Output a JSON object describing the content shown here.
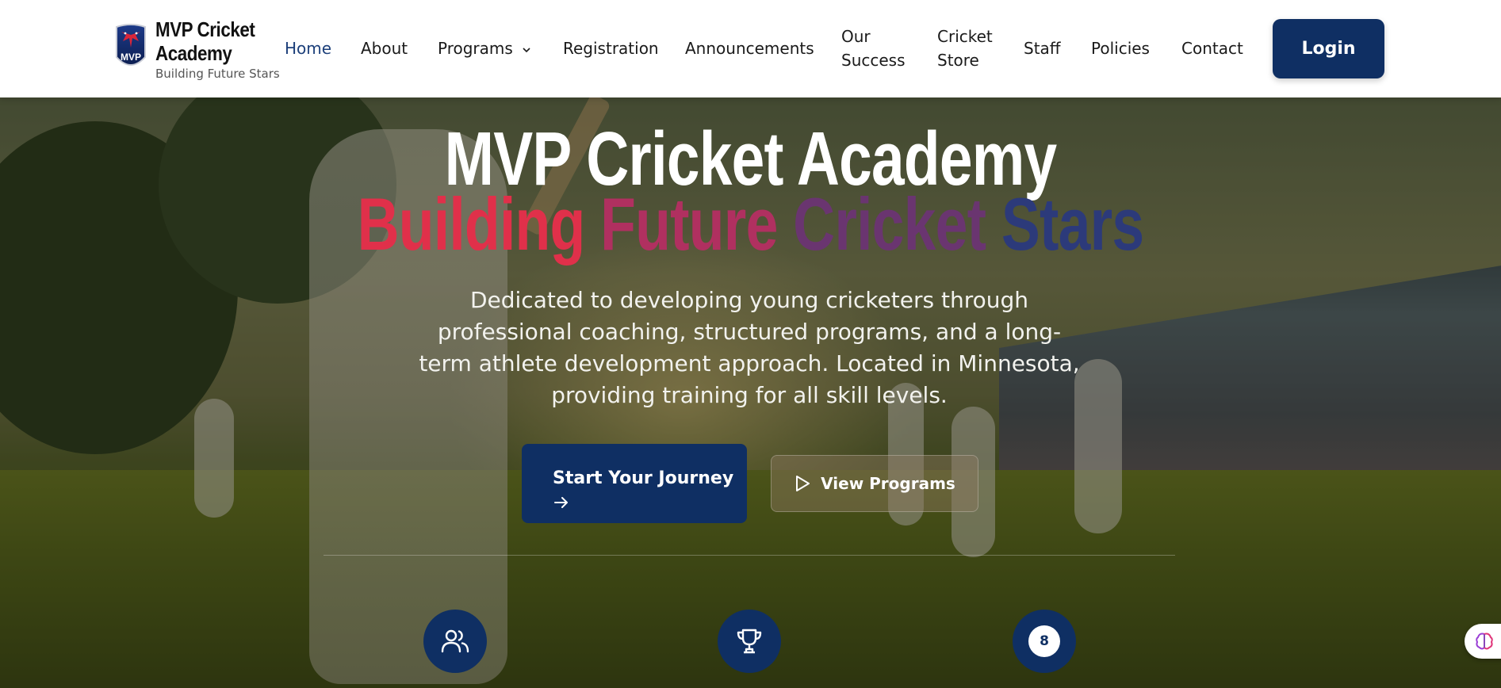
{
  "brand": {
    "name": "MVP Cricket Academy",
    "tagline": "Building Future Stars",
    "logo_text": "MVP"
  },
  "nav": {
    "items": [
      {
        "label": "Home",
        "active": true
      },
      {
        "label": "About"
      },
      {
        "label": "Programs",
        "has_dropdown": true
      },
      {
        "label": "Registration"
      },
      {
        "label": "Announcements"
      },
      {
        "label": "Our Success"
      },
      {
        "label": "Cricket Store"
      },
      {
        "label": "Staff"
      },
      {
        "label": "Policies"
      },
      {
        "label": "Contact"
      }
    ],
    "login_label": "Login"
  },
  "hero": {
    "title": "MVP Cricket Academy",
    "subtitle_words": [
      "Building",
      "Future",
      "Cricket",
      "Stars"
    ],
    "subtitle_colors": [
      "#e0304a",
      "#b03060",
      "#6a3570",
      "#2c3a7a"
    ],
    "description": "Dedicated to developing young cricketers through professional coaching, structured programs, and a long-term athlete development approach. Located in Minnesota, providing training for all skill levels.",
    "primary_cta": "Start Your Journey",
    "secondary_cta": "View Programs"
  },
  "stats": [
    {
      "icon": "users-icon"
    },
    {
      "icon": "trophy-icon"
    },
    {
      "badge": "8"
    }
  ],
  "colors": {
    "primary": "#0f2f63",
    "active_nav": "#1c3f7a"
  }
}
